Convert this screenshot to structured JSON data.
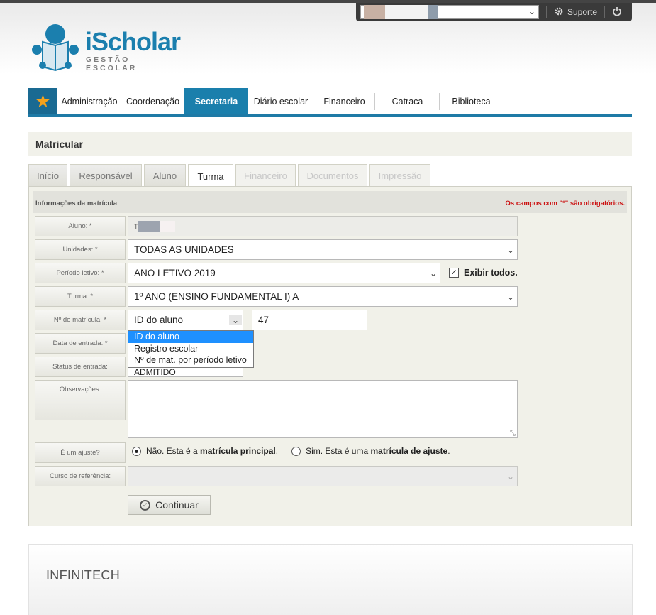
{
  "userbar": {
    "support_label": "Suporte"
  },
  "logo": {
    "name": "iScholar",
    "tagline": "GESTÃO ESCOLAR"
  },
  "nav": {
    "items": [
      {
        "label": "Administração"
      },
      {
        "label": "Coordenação"
      },
      {
        "label": "Secretaria"
      },
      {
        "label": "Diário escolar"
      },
      {
        "label": "Financeiro"
      },
      {
        "label": "Catraca"
      },
      {
        "label": "Biblioteca"
      }
    ],
    "active": "Secretaria"
  },
  "page": {
    "title": "Matricular"
  },
  "tabs": [
    {
      "label": "Início",
      "state": "normal"
    },
    {
      "label": "Responsável",
      "state": "normal"
    },
    {
      "label": "Aluno",
      "state": "normal"
    },
    {
      "label": "Turma",
      "state": "active"
    },
    {
      "label": "Financeiro",
      "state": "disabled"
    },
    {
      "label": "Documentos",
      "state": "disabled"
    },
    {
      "label": "Impressão",
      "state": "disabled"
    }
  ],
  "form": {
    "section_title": "Informações da matrícula",
    "required_note": "Os campos com \"*\" são obrigatórios.",
    "labels": {
      "aluno": "Aluno: *",
      "unidades": "Unidades: *",
      "periodo": "Período letivo: *",
      "turma": "Turma: *",
      "numero": "Nº de matrícula: *",
      "data_entrada": "Data de entrada: *",
      "status_entrada": "Status de entrada:",
      "observacoes": "Observações:",
      "ajuste": "É um ajuste?",
      "curso_ref": "Curso de referência:"
    },
    "aluno_value": "T",
    "unidades_value": "TODAS AS UNIDADES",
    "periodo_value": "ANO LETIVO 2019",
    "exibir_todos_label": "Exibir todos.",
    "turma_value": "1º ANO (ENSINO FUNDAMENTAL I) A",
    "numero_type_value": "ID do aluno",
    "numero_value": "47",
    "numero_type_options": [
      "ID do aluno",
      "Registro escolar",
      "Nº de mat. por período letivo"
    ],
    "status_value": "ADMITIDO",
    "ajuste_options": {
      "nao_prefix": "Não. Esta é a ",
      "nao_bold": "matrícula principal",
      "nao_suffix": ".",
      "sim_prefix": "Sim. Esta é uma ",
      "sim_bold": "matrícula de ajuste",
      "sim_suffix": "."
    },
    "continue_label": "Continuar"
  },
  "footer": {
    "brand": "INFINITECH"
  },
  "colors": {
    "brand_blue": "#1a7fac",
    "star_orange": "#f6a21c",
    "required_red": "#cc1111",
    "selection_blue": "#1e90ff"
  }
}
